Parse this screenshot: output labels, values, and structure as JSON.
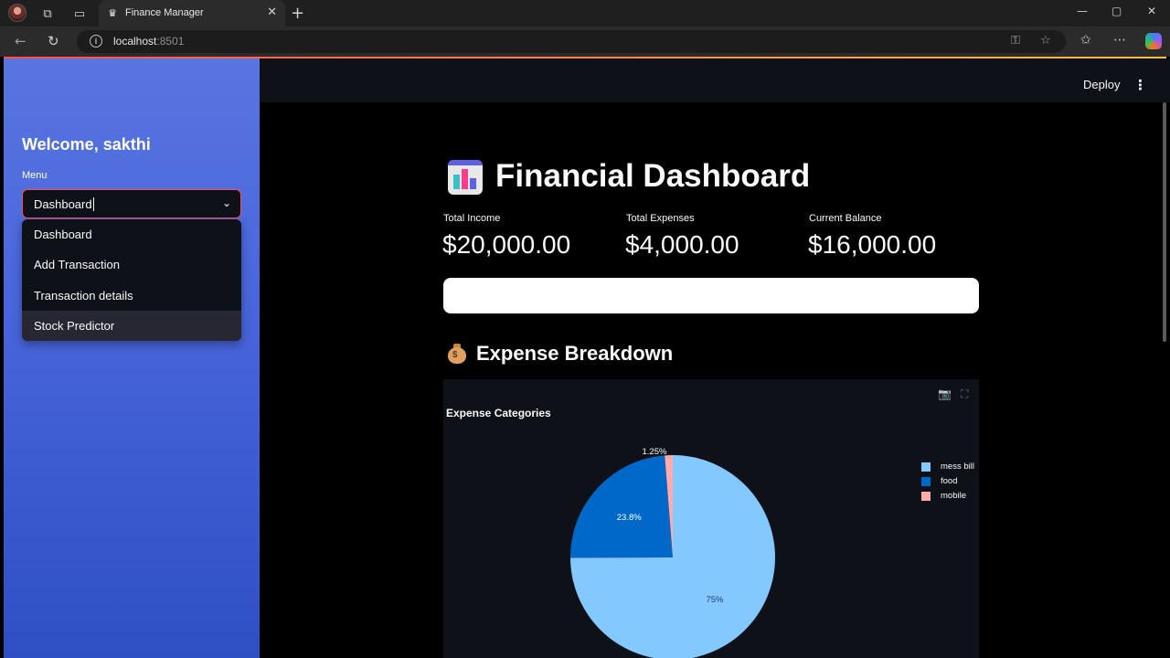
{
  "browser": {
    "tab_title": "Finance Manager",
    "url_host": "localhost",
    "url_port": ":8501"
  },
  "sidebar": {
    "welcome": "Welcome, sakthi",
    "menu_label": "Menu",
    "selected": "Dashboard",
    "options": [
      "Dashboard",
      "Add Transaction",
      "Transaction details",
      "Stock Predictor"
    ]
  },
  "header": {
    "deploy_label": "Deploy"
  },
  "main": {
    "title": "Financial Dashboard",
    "metrics": [
      {
        "label": "Total Income",
        "value": "$20,000.00"
      },
      {
        "label": "Total Expenses",
        "value": "$4,000.00"
      },
      {
        "label": "Current Balance",
        "value": "$16,000.00"
      }
    ],
    "expense_progress": 1.0,
    "section_title": "Expense Breakdown"
  },
  "chart_data": {
    "type": "pie",
    "title": "Expense Categories",
    "labels": [
      "mess bill",
      "food",
      "mobile"
    ],
    "values": [
      75,
      23.8,
      1.25
    ],
    "display_labels": [
      "75%",
      "23.8%",
      "1.25%"
    ],
    "colors": [
      "#83c9ff",
      "#0068c9",
      "#ffabab"
    ],
    "legend": "top-right"
  },
  "icons": {
    "chart_emoji": "bar-chart-emoji-icon",
    "money_bag": "money-bag-icon"
  }
}
